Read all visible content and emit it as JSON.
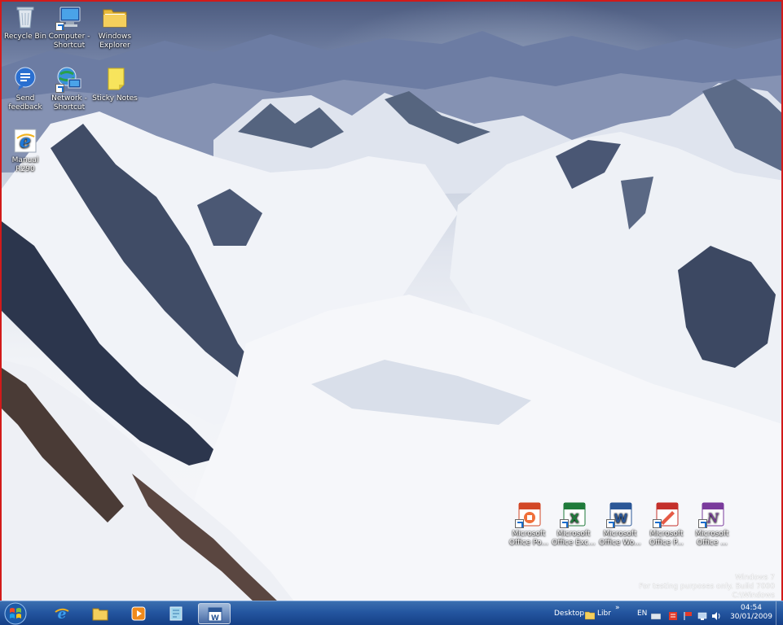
{
  "desktop_icons": [
    {
      "id": "recycle-bin",
      "label_lines": [
        "Recycle Bin"
      ],
      "icon": "recycle-bin-icon",
      "shortcut": false
    },
    {
      "id": "computer-shortcut",
      "label_lines": [
        "Computer -",
        "Shortcut"
      ],
      "icon": "computer-icon",
      "shortcut": true
    },
    {
      "id": "windows-explorer",
      "label_lines": [
        "Windows",
        "Explorer"
      ],
      "icon": "folder-icon",
      "shortcut": false
    },
    {
      "id": "send-feedback",
      "label_lines": [
        "Send",
        "feedback"
      ],
      "icon": "feedback-icon",
      "shortcut": false
    },
    {
      "id": "network-shortcut",
      "label_lines": [
        "Network -",
        "Shortcut"
      ],
      "icon": "network-icon",
      "shortcut": true
    },
    {
      "id": "sticky-notes",
      "label_lines": [
        "Sticky Notes"
      ],
      "icon": "sticky-notes-icon",
      "shortcut": false
    },
    {
      "id": "manual-r290",
      "label_lines": [
        "Manual R290"
      ],
      "icon": "internet-explorer-icon",
      "shortcut": false
    }
  ],
  "office_icons": [
    {
      "id": "office-powerpoint",
      "label_lines": [
        "Microsoft",
        "Office Po..."
      ],
      "icon": "powerpoint-icon",
      "color": "#d24726"
    },
    {
      "id": "office-excel",
      "label_lines": [
        "Microsoft",
        "Office Exc..."
      ],
      "icon": "excel-icon",
      "color": "#1f7a3a"
    },
    {
      "id": "office-word",
      "label_lines": [
        "Microsoft",
        "Office Wo..."
      ],
      "icon": "word-icon",
      "color": "#2b5797"
    },
    {
      "id": "office-publisher",
      "label_lines": [
        "Microsoft",
        "Office P..."
      ],
      "icon": "publisher-icon",
      "color": "#c4302b"
    },
    {
      "id": "office-onenote",
      "label_lines": [
        "Microsoft",
        "Office ..."
      ],
      "icon": "onenote-icon",
      "color": "#7a3b9c"
    }
  ],
  "watermark": {
    "line1": "Windows 7",
    "line2": "For testing purposes only. Build 7000",
    "line3": "C:\\Windows"
  },
  "taskbar": {
    "pinned": [
      {
        "id": "internet-explorer",
        "icon": "internet-explorer-icon"
      },
      {
        "id": "explorer",
        "icon": "folder-icon"
      },
      {
        "id": "media-player",
        "icon": "media-player-icon"
      },
      {
        "id": "sticky-app",
        "icon": "sticky-notes-icon"
      },
      {
        "id": "word",
        "icon": "word-icon",
        "active": true
      }
    ],
    "toolbar_desktop": "Desktop",
    "toolbar_libraries": "Libr",
    "toolbar_more": "»",
    "language": "EN",
    "clock_time": "04:54",
    "clock_date": "30/01/2009"
  },
  "colors": {
    "frame_border": "#d21a1a",
    "taskbar": "#2456a0"
  }
}
